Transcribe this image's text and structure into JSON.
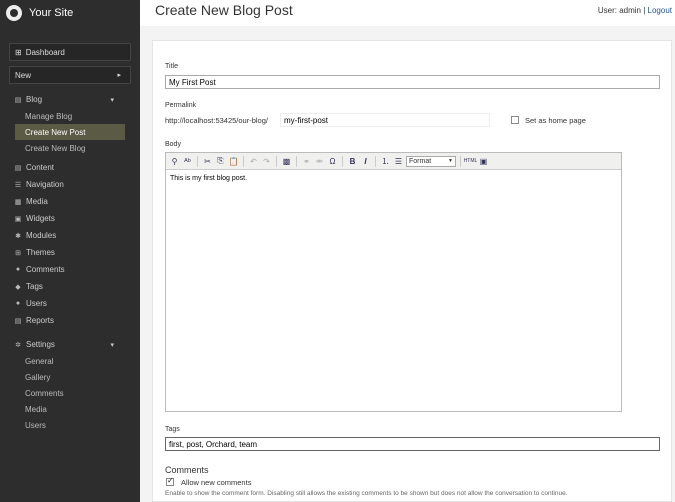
{
  "site": {
    "name": "Your Site"
  },
  "header": {
    "title": "Create New Blog Post",
    "user_prefix": "User: admin |",
    "logout": "Logout"
  },
  "sidebar": {
    "dashboard": "Dashboard",
    "new": "New",
    "blog": {
      "label": "Blog",
      "items": [
        "Manage Blog",
        "Create New Post",
        "Create New Blog"
      ]
    },
    "items": [
      "Content",
      "Navigation",
      "Media",
      "Widgets",
      "Modules",
      "Themes",
      "Comments",
      "Tags",
      "Users",
      "Reports"
    ],
    "settings": {
      "label": "Settings",
      "items": [
        "General",
        "Gallery",
        "Comments",
        "Media",
        "Users"
      ]
    }
  },
  "form": {
    "title_label": "Title",
    "title_value": "My First Post",
    "permalink_label": "Permalink",
    "permalink_prefix": "http://localhost:53425/our-blog/",
    "permalink_value": "my-first-post",
    "home_page_label": "Set as home page",
    "home_page_checked": false,
    "body_label": "Body",
    "body_value": "This is my first blog post.",
    "format_label": "Format",
    "tags_label": "Tags",
    "tags_value": "first, post, Orchard, team",
    "comments_title": "Comments",
    "allow_comments_label": "Allow new comments",
    "allow_comments_checked": true,
    "comments_hint": "Enable to show the comment form. Disabling still allows the existing comments to be shown but does not allow the conversation to continue."
  },
  "colors": {
    "sidebar_bg": "#2d2d2d",
    "active_item_bg": "#5a5a45",
    "link": "#1e5494"
  }
}
